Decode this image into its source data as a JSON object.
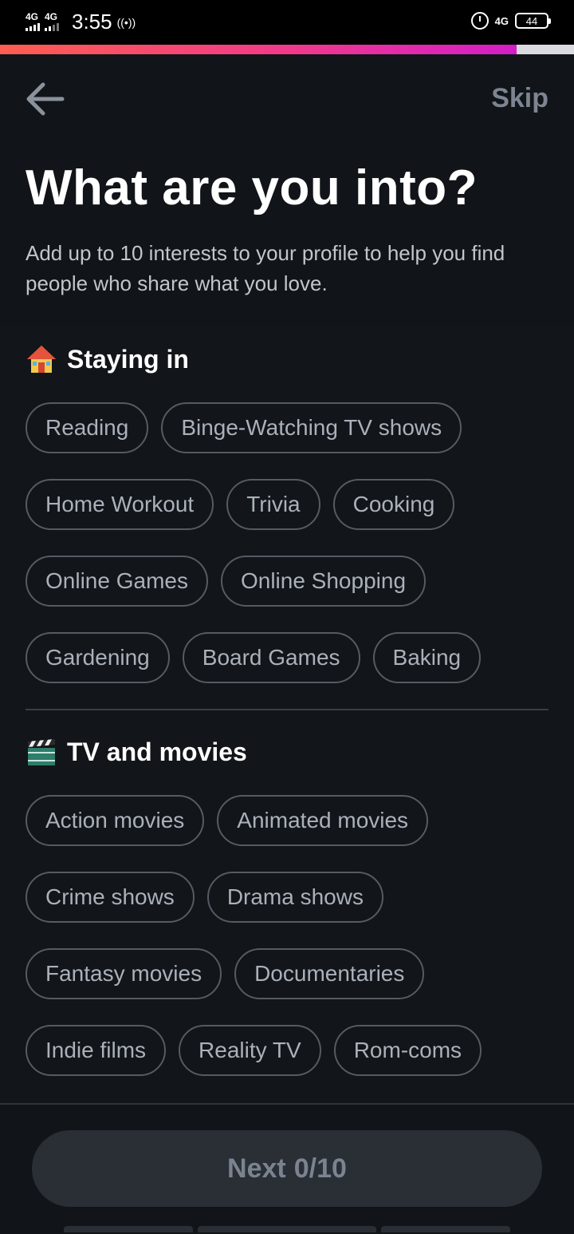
{
  "status_bar": {
    "sim1_label": "4G",
    "sim2_label": "4G",
    "time": "3:55",
    "hotspot_icon": "hotspot-icon",
    "net_label": "4G",
    "battery": "44"
  },
  "progress": {
    "fraction": 0.9
  },
  "header": {
    "back_icon": "arrow-left-icon",
    "skip_label": "Skip"
  },
  "title": "What are you into?",
  "subtitle": "Add up to 10 interests to your profile to help you find people who share what you love.",
  "sections": [
    {
      "icon": "house-icon",
      "title": "Staying in",
      "rows": [
        [
          "Reading",
          "Binge-Watching TV shows"
        ],
        [
          "Home Workout",
          "Trivia",
          "Cooking"
        ],
        [
          "Online Games",
          "Online Shopping"
        ],
        [
          "Gardening",
          "Board Games",
          "Baking"
        ]
      ]
    },
    {
      "icon": "clapper-board-icon",
      "title": "TV and movies",
      "rows": [
        [
          "Action movies",
          "Animated movies"
        ],
        [
          "Crime shows",
          "Drama shows"
        ],
        [
          "Fantasy movies",
          "Documentaries"
        ],
        [
          "Indie films",
          "Reality TV",
          "Rom-coms"
        ]
      ]
    }
  ],
  "next_button": {
    "label": "Next",
    "count": "0/10"
  },
  "colors": {
    "background": "#111418",
    "chip_border": "#555b64",
    "chip_text": "#aab1ba",
    "progress_start": "#fd5e50",
    "progress_end": "#d31ec8",
    "next_bg": "#2a2e35"
  }
}
